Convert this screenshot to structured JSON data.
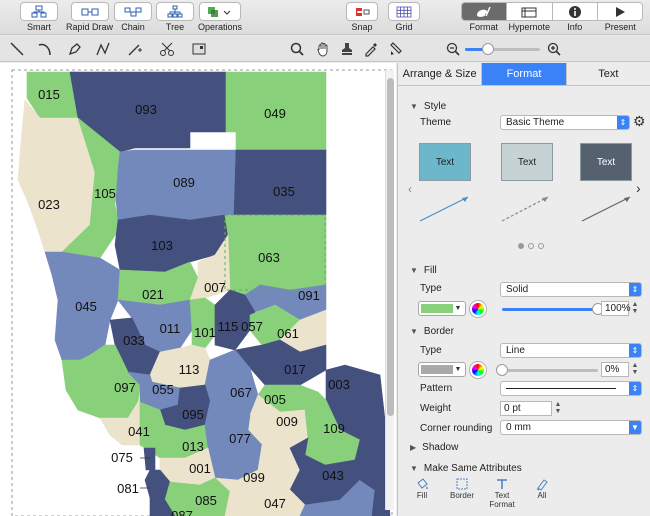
{
  "toolbar": {
    "left_buttons": [
      {
        "label": "Smart",
        "icon": "smart-diagram-icon"
      },
      {
        "label": "Rapid Draw",
        "icon": "rapid-draw-icon"
      },
      {
        "label": "Chain",
        "icon": "chain-icon"
      },
      {
        "label": "Tree",
        "icon": "tree-icon"
      },
      {
        "label": "Operations",
        "icon": "operations-icon"
      }
    ],
    "snap_label": "Snap",
    "grid_label": "Grid",
    "inspectors": [
      {
        "label": "Format",
        "icon": "format-icon",
        "active": true
      },
      {
        "label": "Hypernote",
        "icon": "hypernote-icon",
        "active": false
      },
      {
        "label": "Info",
        "icon": "info-icon",
        "active": false
      },
      {
        "label": "Present",
        "icon": "present-icon",
        "active": false
      }
    ]
  },
  "zoom": {
    "level": 0.3
  },
  "map": {
    "colors": {
      "navy": "#44517f",
      "steel": "#7489bb",
      "green": "#88d07a",
      "tan": "#ece3cc"
    },
    "counties": [
      {
        "code": "015"
      },
      {
        "code": "093"
      },
      {
        "code": "049"
      },
      {
        "code": "023"
      },
      {
        "code": "105"
      },
      {
        "code": "089"
      },
      {
        "code": "035"
      },
      {
        "code": "103"
      },
      {
        "code": "063"
      },
      {
        "code": "045"
      },
      {
        "code": "021"
      },
      {
        "code": "007"
      },
      {
        "code": "091"
      },
      {
        "code": "011"
      },
      {
        "code": "101"
      },
      {
        "code": "115"
      },
      {
        "code": "057"
      },
      {
        "code": "061"
      },
      {
        "code": "033"
      },
      {
        "code": "113"
      },
      {
        "code": "017"
      },
      {
        "code": "097"
      },
      {
        "code": "055"
      },
      {
        "code": "067"
      },
      {
        "code": "003"
      },
      {
        "code": "005"
      },
      {
        "code": "095"
      },
      {
        "code": "009"
      },
      {
        "code": "109"
      },
      {
        "code": "041"
      },
      {
        "code": "013"
      },
      {
        "code": "077"
      },
      {
        "code": "075"
      },
      {
        "code": "001"
      },
      {
        "code": "099"
      },
      {
        "code": "043"
      },
      {
        "code": "081"
      },
      {
        "code": "085"
      },
      {
        "code": "047"
      },
      {
        "code": "087"
      }
    ]
  },
  "panel": {
    "tabs": [
      {
        "label": "Arrange & Size",
        "active": false
      },
      {
        "label": "Format",
        "active": true
      },
      {
        "label": "Text",
        "active": false
      }
    ],
    "style": {
      "heading": "Style",
      "theme_label": "Theme",
      "theme_value": "Basic Theme",
      "thumb_text": "Text",
      "thumb_colors": [
        "#6cb7c9",
        "#c7d2d4",
        "#566170"
      ]
    },
    "fill": {
      "heading": "Fill",
      "type_label": "Type",
      "type_value": "Solid",
      "color": "#88d07a",
      "opacity_text": "100%",
      "opacity": 1.0
    },
    "border": {
      "heading": "Border",
      "type_label": "Type",
      "type_value": "Line",
      "color": "#a9a9a9",
      "opacity_text": "0%",
      "opacity": 0.0,
      "pattern_label": "Pattern",
      "weight_label": "Weight",
      "weight_value": "0 pt",
      "corner_label": "Corner rounding",
      "corner_value": "0 mm"
    },
    "shadow": {
      "heading": "Shadow"
    },
    "make_same": {
      "heading": "Make Same Attributes",
      "buttons": [
        {
          "label": "Fill",
          "icon": "fill-attr-icon"
        },
        {
          "label": "Border",
          "icon": "border-attr-icon"
        },
        {
          "label": "Text Format",
          "icon": "text-format-icon"
        },
        {
          "label": "All",
          "icon": "all-attr-icon"
        }
      ]
    }
  }
}
